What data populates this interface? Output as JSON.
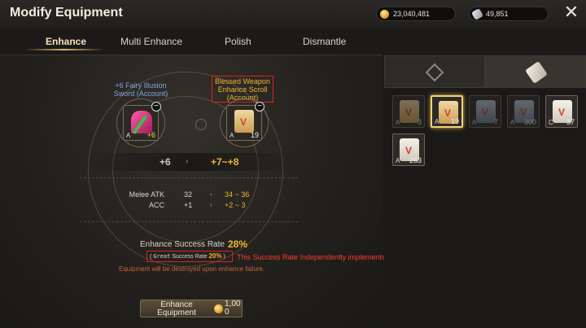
{
  "window": {
    "title": "Modify Equipment"
  },
  "currency": {
    "gold": "23,040,481",
    "gems": "49,851"
  },
  "tabs": [
    "Enhance",
    "Multi Enhance",
    "Polish",
    "Dismantle"
  ],
  "left": {
    "weapon": {
      "name_line1": "+6 Fairy Illusion",
      "name_line2": "Sword (Account)",
      "grade": "A",
      "level": "+6"
    },
    "scroll": {
      "name_line1": "Blessed Weapon",
      "name_line2": "Enhance Scroll",
      "name_line3": "(Account)",
      "grade": "A",
      "count": "19"
    },
    "enhance_from": "+6",
    "enhance_to": "+7~+8",
    "stats": [
      {
        "label": "Melee ATK",
        "current": "32",
        "next": "34 ~ 36"
      },
      {
        "label": "ACC",
        "current": "+1",
        "next": "+2 ~ 3"
      }
    ],
    "success_label": "Enhance Success Rate",
    "success_value": "28%",
    "great_label": "Great",
    "great_suffix": "Success Rate",
    "great_value": "20%",
    "warning": "Equipment will be destroyed upon enhance failure.",
    "button_line1": "Enhance",
    "button_line2": "Equipment",
    "cost_line1": "1,00",
    "cost_line2": "0"
  },
  "annotation": "This Success Rate Independently implements when enhance is successful.",
  "inventory": [
    {
      "grade": "A",
      "count": "3",
      "dim": true,
      "art": "gold"
    },
    {
      "grade": "A",
      "count": "19",
      "dim": false,
      "art": "gold",
      "selected": true
    },
    {
      "grade": "A",
      "count": "7",
      "dim": true,
      "art": "blue"
    },
    {
      "grade": "A",
      "count": "300",
      "dim": true,
      "art": "blue"
    },
    {
      "grade": "C",
      "count": "37",
      "dim": false,
      "art": "white"
    },
    {
      "grade": "A",
      "count": "263",
      "dim": false,
      "art": "white"
    }
  ]
}
